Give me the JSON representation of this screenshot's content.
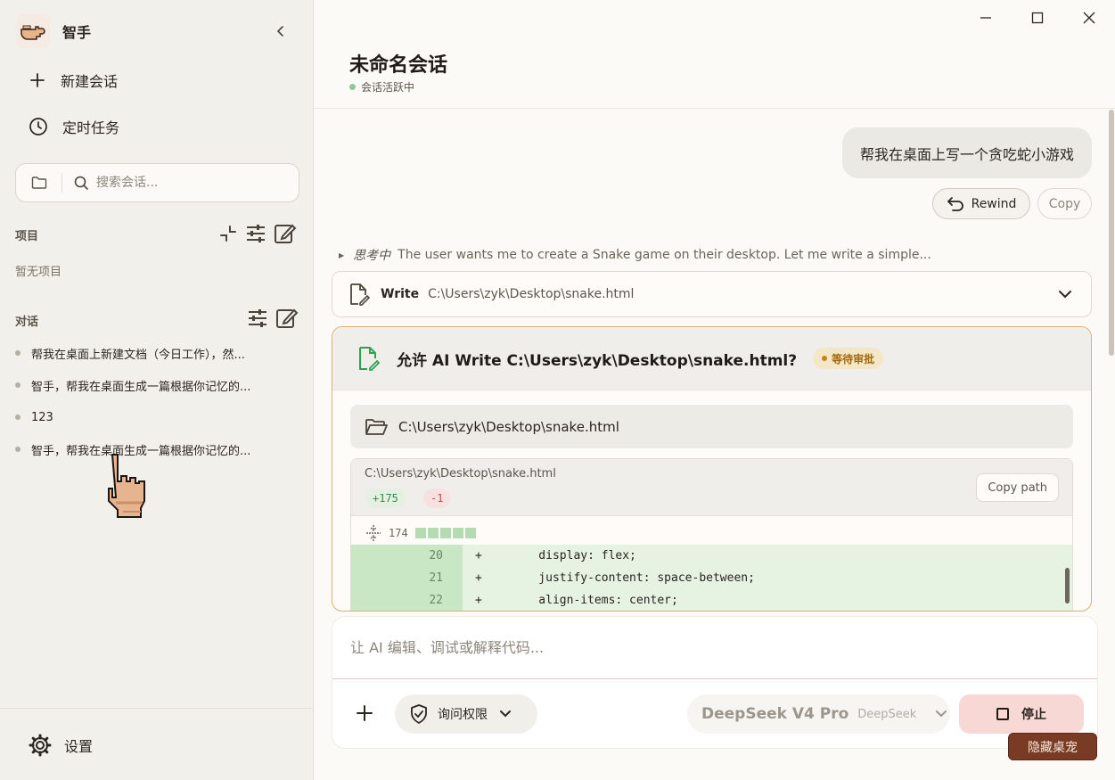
{
  "sidebar": {
    "brand_name": "智手",
    "nav": [
      {
        "label": "新建会话",
        "icon": "plus-icon"
      },
      {
        "label": "定时任务",
        "icon": "clock-icon"
      }
    ],
    "search_placeholder": "搜索会话...",
    "projects_title": "项目",
    "projects_empty": "暂无项目",
    "conversations_title": "对话",
    "conversations": [
      "帮我在桌面上新建文档（今日工作），然...",
      "智手，帮我在桌面生成一篇根据你记忆的...",
      "123",
      "智手，帮我在桌面生成一篇根据你记忆的..."
    ],
    "settings_label": "设置"
  },
  "header": {
    "title": "未命名会话",
    "status": "会话活跃中"
  },
  "chat": {
    "user_message": "帮我在桌面上写一个贪吃蛇小游戏",
    "rewind_label": "Rewind",
    "copy_label": "Copy",
    "thinking_label": "思考中",
    "thinking_text": "The user wants me to create a Snake game on their desktop. Let me write a simple...",
    "tool": {
      "name": "Write",
      "path": "C:\\Users\\zyk\\Desktop\\snake.html"
    },
    "approval": {
      "title": "允许 AI Write C:\\Users\\zyk\\Desktop\\snake.html?",
      "badge": "等待审批",
      "path": "C:\\Users\\zyk\\Desktop\\snake.html",
      "diff_file": "C:\\Users\\zyk\\Desktop\\snake.html",
      "additions": "+175",
      "deletions": "-1",
      "copy_path_label": "Copy path",
      "hunk_count": "174",
      "lines": [
        {
          "num": "20",
          "sign": "+",
          "text": "    display: flex;"
        },
        {
          "num": "21",
          "sign": "+",
          "text": "    justify-content: space-between;"
        },
        {
          "num": "22",
          "sign": "+",
          "text": "    align-items: center;"
        }
      ]
    }
  },
  "composer": {
    "placeholder": "让 AI 编辑、调试或解释代码...",
    "permission_label": "询问权限",
    "model_name": "DeepSeek V4 Pro",
    "model_provider": "DeepSeek",
    "stop_label": "停止",
    "hide_pet_label": "隐藏桌宠"
  },
  "colors": {
    "accent_pending": "#c4860c",
    "active_status": "#8fc99a",
    "stop_bg": "#f8d8d4",
    "diff_added": "#e6f3e3"
  }
}
